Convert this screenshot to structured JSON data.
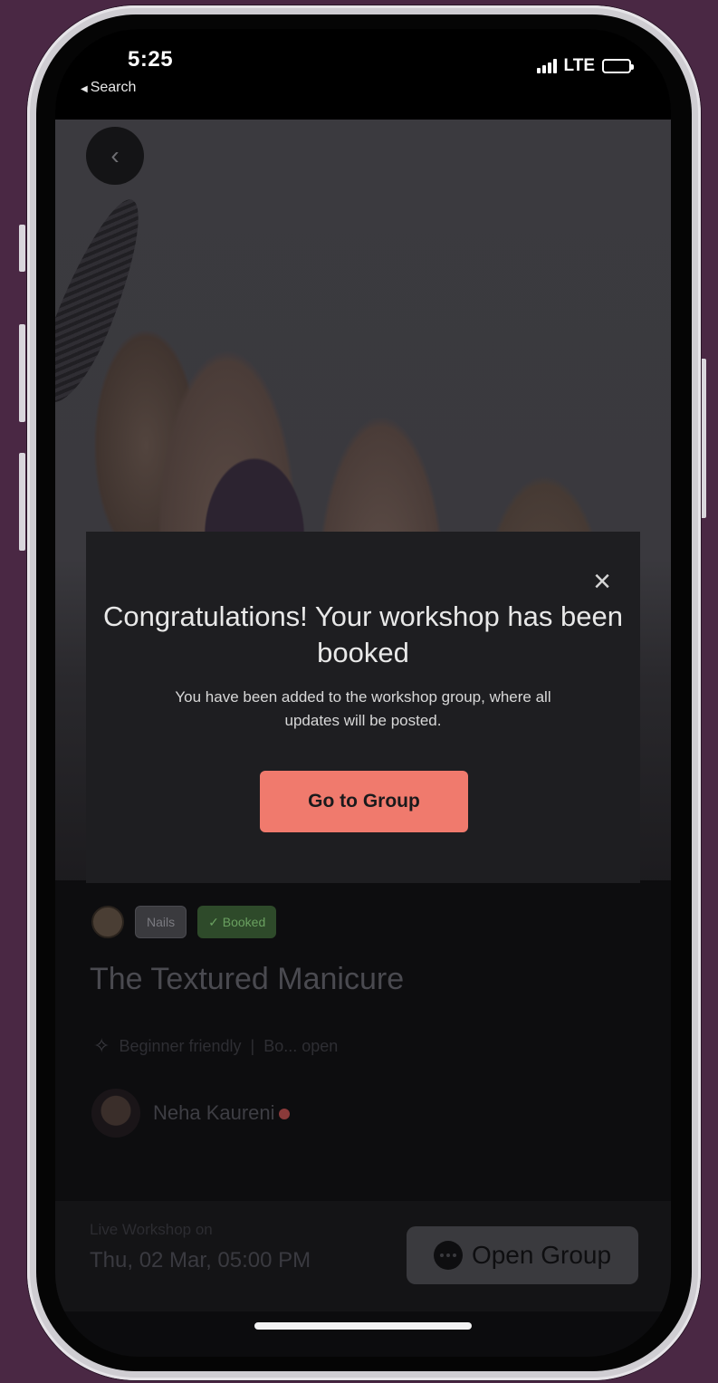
{
  "status_bar": {
    "time": "5:25",
    "back_label": "Search",
    "network": "LTE"
  },
  "workshop": {
    "tags": [
      "Nails",
      "Booked"
    ],
    "title": "The Textured Manicure",
    "level": "Beginner friendly",
    "language": "Bo... open",
    "host_name": "Neha Kaureni"
  },
  "bottom_bar": {
    "live_label": "Live Workshop on",
    "live_date": "Thu, 02 Mar, 05:00 PM",
    "open_group_label": "Open Group"
  },
  "modal": {
    "title": "Congratulations! Your workshop has been booked",
    "body": "You have been added to the workshop group, where all updates will be posted.",
    "cta_label": "Go to Group",
    "close_symbol": "×"
  },
  "colors": {
    "background": "#4a2844",
    "modal_bg": "#1e1e21",
    "cta": "#f07a6d",
    "booked_tag": "#2e4a2a"
  }
}
